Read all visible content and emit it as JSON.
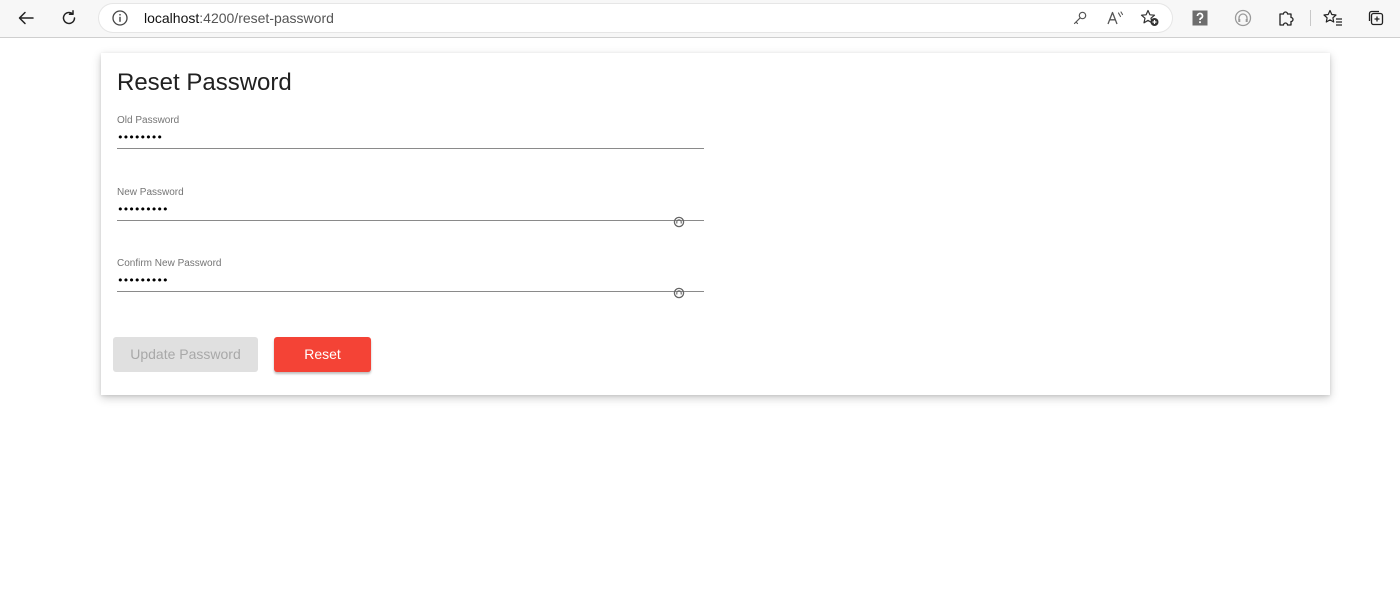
{
  "browser": {
    "url_host": "localhost",
    "url_path": ":4200/reset-password",
    "icons": {
      "back": "arrow-left-icon",
      "refresh": "refresh-icon",
      "site_info": "info-icon",
      "password_manager": "key-icon",
      "read_aloud": "read-aloud-icon",
      "add_favorite": "star-plus-icon",
      "help_extension": "question-icon",
      "tracking": "headphones-icon",
      "extensions": "puzzle-icon",
      "favorites": "favorites-list-icon",
      "collections": "collections-icon"
    }
  },
  "form": {
    "title": "Reset Password",
    "fields": [
      {
        "label": "Old Password",
        "value": "••••••••"
      },
      {
        "label": "New Password",
        "value": "•••••••••"
      },
      {
        "label": "Confirm New Password",
        "value": "•••••••••"
      }
    ],
    "buttons": {
      "update_label": "Update Password",
      "reset_label": "Reset"
    }
  },
  "colors": {
    "reset_button": "#f44336",
    "update_button_disabled": "#e0e0e0",
    "title_text": "#212121",
    "label_text": "#757575"
  }
}
